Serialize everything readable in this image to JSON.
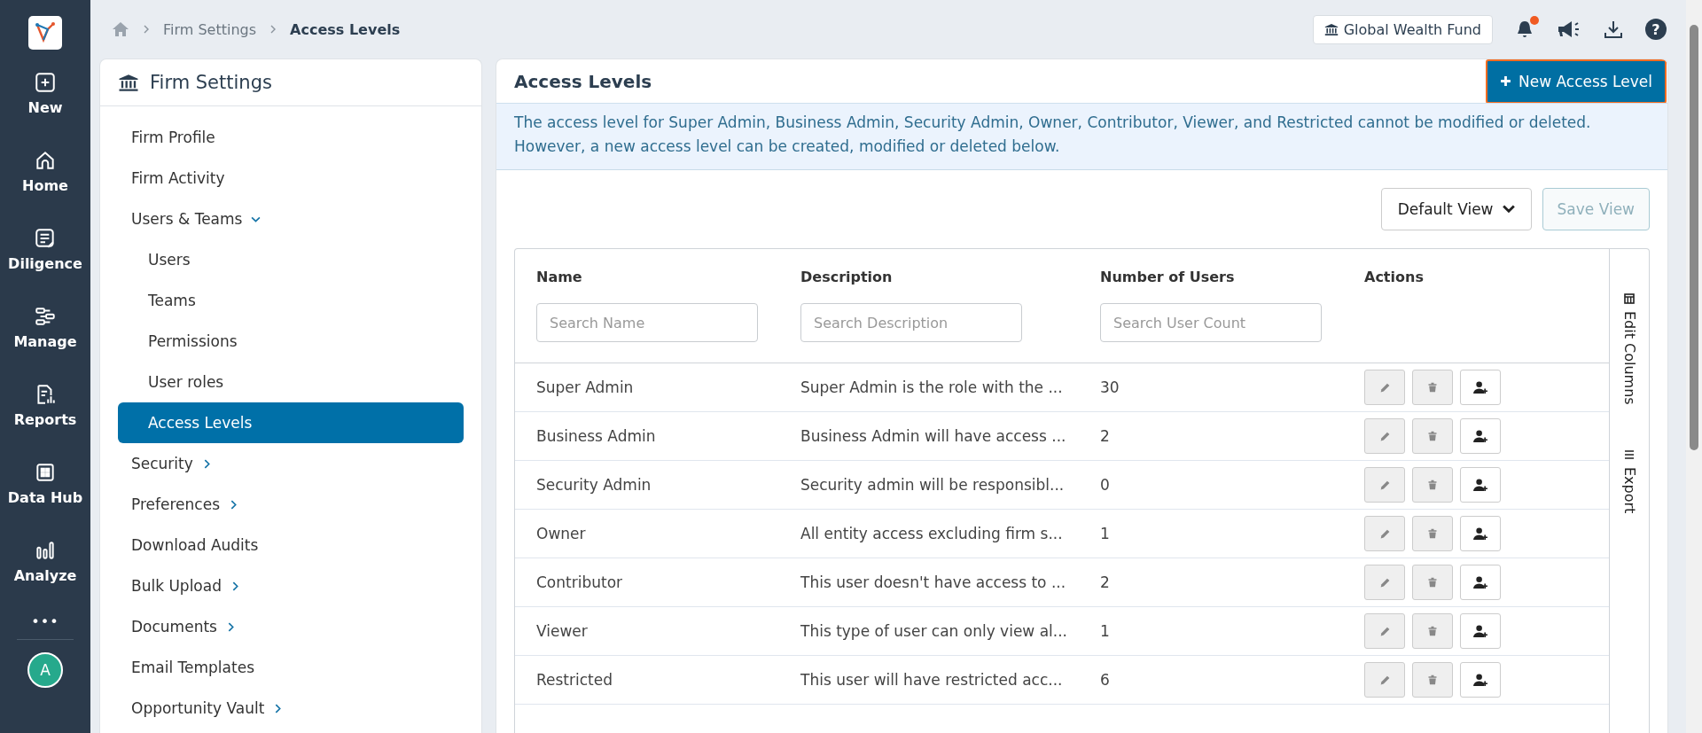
{
  "nav": {
    "items": [
      {
        "label": "New",
        "selected": false
      },
      {
        "label": "Home",
        "selected": false
      },
      {
        "label": "Diligence",
        "selected": false
      },
      {
        "label": "Manage",
        "selected": false
      },
      {
        "label": "Reports",
        "selected": false
      },
      {
        "label": "Data Hub",
        "selected": false
      },
      {
        "label": "Analyze",
        "selected": false
      }
    ],
    "more": "•••",
    "avatar": "A"
  },
  "breadcrumb": [
    "Firm Settings",
    "Access Levels"
  ],
  "topbar": {
    "fund": "Global Wealth Fund",
    "notification": true,
    "help": "?"
  },
  "sidebar": {
    "title": "Firm Settings",
    "items": [
      {
        "label": "Firm Profile",
        "selected": false
      },
      {
        "label": "Firm Activity",
        "selected": false
      },
      {
        "label": "Users & Teams",
        "selected": false,
        "expanded": true,
        "children": [
          {
            "label": "Users",
            "selected": false
          },
          {
            "label": "Teams",
            "selected": false
          },
          {
            "label": "Permissions",
            "selected": false
          },
          {
            "label": "User roles",
            "selected": false
          },
          {
            "label": "Access Levels",
            "selected": true
          }
        ]
      },
      {
        "label": "Security",
        "selected": false,
        "expanded": false
      },
      {
        "label": "Preferences",
        "selected": false,
        "expanded": false
      },
      {
        "label": "Download Audits",
        "selected": false
      },
      {
        "label": "Bulk Upload",
        "selected": false,
        "expanded": false
      },
      {
        "label": "Documents",
        "selected": false,
        "expanded": false
      },
      {
        "label": "Email Templates",
        "selected": false
      },
      {
        "label": "Opportunity Vault",
        "selected": false,
        "expanded": false
      }
    ]
  },
  "main": {
    "title": "Access Levels",
    "new_button": "New Access Level",
    "notice": "The access level for Super Admin, Business Admin, Security Admin, Owner, Contributor, Viewer, and Restricted cannot be modified or deleted. However, a new access level can be created, modified or deleted below.",
    "view_select": "Default View",
    "save_view": {
      "label": "Save View",
      "disabled": true
    }
  },
  "table": {
    "columns": [
      {
        "label": "Name",
        "placeholder": "Search Name"
      },
      {
        "label": "Description",
        "placeholder": "Search Description"
      },
      {
        "label": "Number of Users",
        "placeholder": "Search User Count"
      },
      {
        "label": "Actions"
      }
    ],
    "rows": [
      {
        "name": "Super Admin",
        "description": "Super Admin is the role with the ...",
        "users": "30",
        "locked": true
      },
      {
        "name": "Business Admin",
        "description": "Business Admin will have access ...",
        "users": "2",
        "locked": true
      },
      {
        "name": "Security Admin",
        "description": "Security admin will be responsibl...",
        "users": "0",
        "locked": true
      },
      {
        "name": "Owner",
        "description": "All entity access excluding firm s...",
        "users": "1",
        "locked": true
      },
      {
        "name": "Contributor",
        "description": "This user doesn't have access to ...",
        "users": "2",
        "locked": true
      },
      {
        "name": "Viewer",
        "description": "This type of user can only view al...",
        "users": "1",
        "locked": true
      },
      {
        "name": "Restricted",
        "description": "This user will have restricted acc...",
        "users": "6",
        "locked": true
      }
    ],
    "side_tools": [
      "Edit Columns",
      "Export"
    ]
  }
}
